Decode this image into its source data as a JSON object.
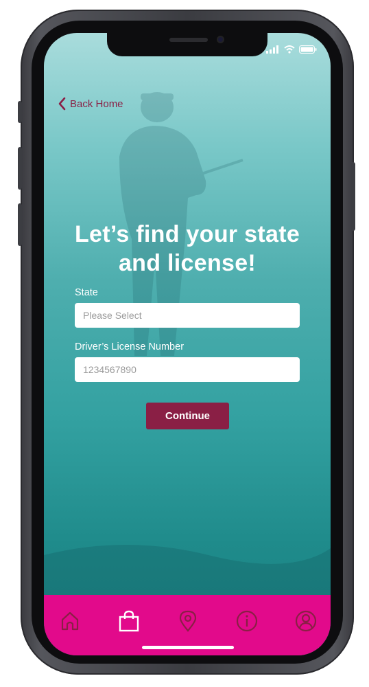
{
  "nav": {
    "back_label": "Back Home"
  },
  "headline": {
    "line1": "Let’s find your state",
    "line2": "and license!"
  },
  "form": {
    "state_label": "State",
    "state_placeholder": "Please Select",
    "license_label": "Driver’s License Number",
    "license_placeholder": "1234567890",
    "continue_label": "Continue"
  },
  "tabbar": {
    "items": [
      {
        "icon": "home-icon",
        "active": false
      },
      {
        "icon": "shopping-bag-icon",
        "active": true
      },
      {
        "icon": "location-pin-icon",
        "active": false
      },
      {
        "icon": "info-icon",
        "active": false
      },
      {
        "icon": "profile-icon",
        "active": false
      }
    ]
  },
  "colors": {
    "accent": "#8a1f45",
    "tabbar": "#e20a8b",
    "inactive_icon": "#8a1f45",
    "active_icon": "#ffffff"
  }
}
